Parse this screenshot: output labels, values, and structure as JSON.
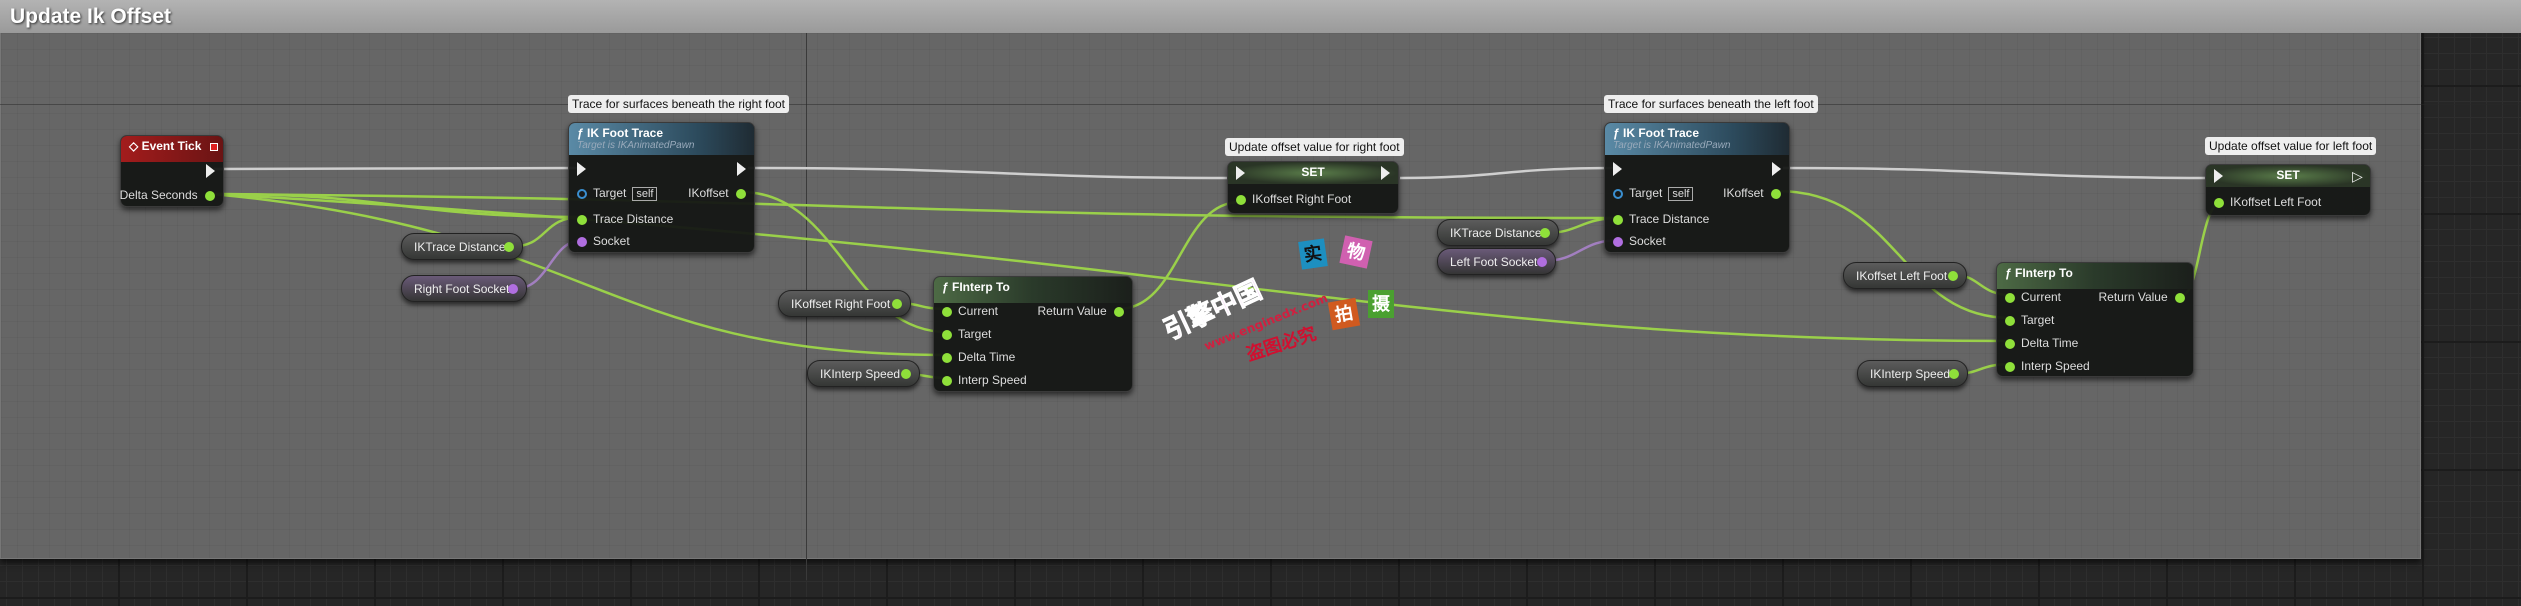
{
  "comment": {
    "title": "Update Ik Offset"
  },
  "event_tick": {
    "title": "Event Tick",
    "pin_delta": "Delta Seconds"
  },
  "trace_right": {
    "tooltip": "Trace for surfaces beneath the right foot",
    "title": "IK Foot Trace",
    "subtitle": "Target is IKAnimatedPawn",
    "target": "Target",
    "self": "self",
    "trace_distance": "Trace Distance",
    "socket": "Socket",
    "out": "IKoffset"
  },
  "trace_left": {
    "tooltip": "Trace for surfaces beneath the left foot",
    "title": "IK Foot Trace",
    "subtitle": "Target is IKAnimatedPawn",
    "target": "Target",
    "self": "self",
    "trace_distance": "Trace Distance",
    "socket": "Socket",
    "out": "IKoffset"
  },
  "vars": {
    "ik_trace_distance_r": "IKTrace Distance",
    "right_foot_socket": "Right Foot Socket",
    "ikoffset_right_foot": "IKoffset Right Foot",
    "ik_interp_speed_r": "IKInterp Speed",
    "ik_trace_distance_l": "IKTrace Distance",
    "left_foot_socket": "Left Foot Socket",
    "ikoffset_left_foot": "IKoffset Left Foot",
    "ik_interp_speed_l": "IKInterp Speed"
  },
  "finterp_right": {
    "title": "FInterp To",
    "current": "Current",
    "target": "Target",
    "delta_time": "Delta Time",
    "interp_speed": "Interp Speed",
    "return_value": "Return Value"
  },
  "finterp_left": {
    "title": "FInterp To",
    "current": "Current",
    "target": "Target",
    "delta_time": "Delta Time",
    "interp_speed": "Interp Speed",
    "return_value": "Return Value"
  },
  "set_right": {
    "tooltip": "Update offset value for right foot",
    "title": "SET",
    "pin": "IKoffset Right Foot"
  },
  "set_left": {
    "tooltip": "Update offset value for left foot",
    "title": "SET",
    "pin": "IKoffset Left Foot"
  },
  "watermark": {
    "brand": "引擎中国",
    "url": "www.enginedx.com",
    "notice": "盗图必究",
    "c1": "实",
    "c2": "物",
    "c3": "拍",
    "c4": "摄"
  },
  "colors": {
    "float_pin": "#8fe03a",
    "name_pin": "#b06ee0",
    "exec_wire": "#cfcfcf",
    "event_header": "#a31c1c",
    "function_header": "#5a8aa6"
  }
}
